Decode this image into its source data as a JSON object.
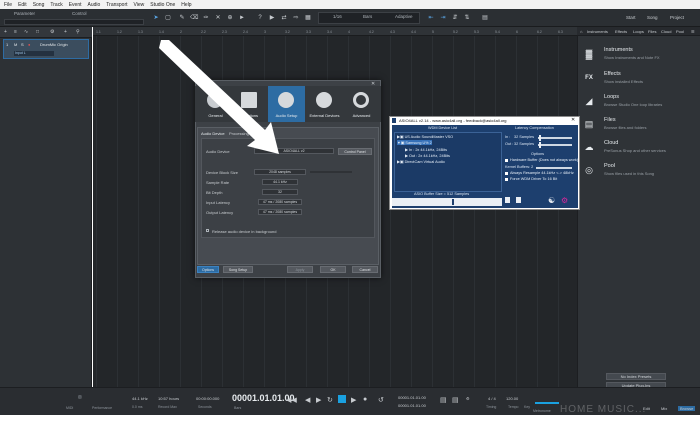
{
  "menubar": [
    "File",
    "Edit",
    "Song",
    "Track",
    "Event",
    "Audio",
    "Transport",
    "View",
    "Studio One",
    "Help"
  ],
  "toolbar": {
    "parameter_label": "Parameter",
    "control_label": "Control",
    "quantize": "1/16",
    "timebase": "Bars",
    "snap": "Adaptive",
    "start": "Start",
    "song": "Song",
    "project": "Project"
  },
  "track": {
    "name": "DrumMic Origin",
    "input": "Input L",
    "m": "M",
    "s": "S",
    "r": "●"
  },
  "ruler": [
    "1.1",
    "1.2",
    "1.3",
    "1.4",
    "2",
    "2.2",
    "2.3",
    "2.4",
    "3",
    "3.2",
    "3.3",
    "3.4",
    "4",
    "4.2",
    "4.3",
    "4.4",
    "5",
    "5.2",
    "5.3",
    "5.4",
    "6",
    "6.2",
    "6.3"
  ],
  "browser": {
    "tabs": [
      "Instruments",
      "Effects",
      "Loops",
      "Files",
      "Cloud",
      "Pool"
    ],
    "items": [
      {
        "icon": "▓",
        "title": "Instruments",
        "desc": "Show Instruments and Note FX"
      },
      {
        "icon": "FX",
        "title": "Effects",
        "desc": "Show installed Effects"
      },
      {
        "icon": "◢",
        "title": "Loops",
        "desc": "Browse Studio One loop libraries"
      },
      {
        "icon": "▤",
        "title": "Files",
        "desc": "Browse files and folders"
      },
      {
        "icon": "☁",
        "title": "Cloud",
        "desc": "PreSonus Shop and other services"
      },
      {
        "icon": "◎",
        "title": "Pool",
        "desc": "Show files used in this Song"
      }
    ],
    "no_index": "No Index Presets",
    "update": "Update Plug-Ins"
  },
  "dialog": {
    "tabs": [
      "General",
      "Locations",
      "Audio Setup",
      "External Devices",
      "Advanced"
    ],
    "subtabs": [
      "Audio Device",
      "Processing"
    ],
    "audio_device_label": "Audio Device",
    "audio_device": "ASIO4ALL v2",
    "control_panel": "Control Panel",
    "block_size_label": "Device Block Size",
    "block_size": "2048 samples",
    "sample_rate_label": "Sample Rate",
    "sample_rate": "44.1 kHz",
    "bit_depth_label": "Bit Depth",
    "bit_depth": "32",
    "input_latency_label": "Input Latency",
    "input_latency": "47 ms / 2080 samples",
    "output_latency_label": "Output Latency",
    "output_latency": "47 ms / 2080 samples",
    "release_label": "Release audio device in background",
    "options": "Options",
    "song_setup": "Song Setup",
    "apply": "Apply",
    "ok": "OK",
    "cancel": "Cancel"
  },
  "asio": {
    "title": "ASIO4ALL v2.14 - www.asio4all.org - feedback@asio4all.org",
    "device_list": "WDM Device List",
    "latency_comp": "Latency Compensation",
    "in_label": "In :",
    "in_value": "32 Samples",
    "out_label": "Out :",
    "out_value": "32 Samples",
    "options": "Options",
    "devices": [
      "US Audio SoundMaster VSO",
      "Samsung U% 2",
      "In : 2x 44.1kHz, 24Bits",
      "Out : 2x 44.1kHz, 24Bits",
      "DirectCam Virtual Audio"
    ],
    "checkboxes": [
      "Hardware Buffer (Does not always work)",
      "Always Resample 44.1kHz <-> 48kHz",
      "Force WDM Driver To 16 Bit"
    ],
    "kernel_buffers": "Kernel Buffers: 2",
    "buffer_size": "ASIO Buffer Size = 512 Samples"
  },
  "transport": {
    "midi": "MIDI",
    "performance": "Performance",
    "sample_rate": "44.1 kHz",
    "time": "0.0 ms",
    "record_time": "10:57 hours",
    "record_max": "Record Max",
    "seconds_value": "00:00:00.000",
    "seconds": "Seconds",
    "bars_value": "00001.01.01.00",
    "bars": "Bars",
    "loop_start": "00001.01.01.00",
    "loop_end": "00001.01.01.00",
    "sig": "4 / 4",
    "timing": "Timing",
    "tempo_value": "120.00",
    "tempo": "Tempo",
    "key": "Key",
    "metronome": "Metronome",
    "edit": "Edit",
    "mix": "Mix",
    "browse": "Browse"
  },
  "watermark": "HOME MUSIC..."
}
